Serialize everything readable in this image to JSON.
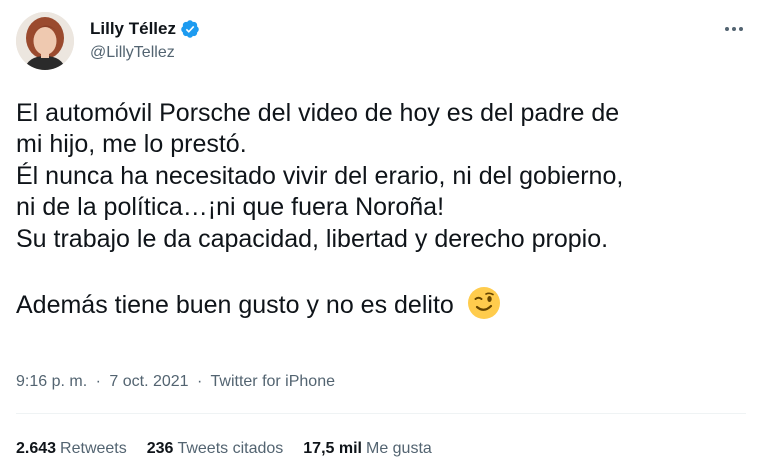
{
  "author": {
    "name": "Lilly Téllez",
    "handle": "@LillyTellez",
    "verified": true,
    "verified_color": "#1d9bf0"
  },
  "menu_icon": "more-horizontal-icon",
  "tweet": {
    "lines": [
      "El automóvil Porsche del video de hoy es del padre de",
      "mi hijo, me lo prestó.",
      "Él nunca ha necesitado vivir del erario, ni del gobierno,",
      "ni de la política…¡ni que fuera Noroña!",
      "Su trabajo le da capacidad, libertad y derecho propio.",
      "Además tiene buen gusto y no es delito"
    ],
    "emoji": "winking-face-emoji"
  },
  "meta": {
    "time": "9:16 p. m.",
    "separator": "·",
    "date": "7 oct. 2021",
    "source": "Twitter for iPhone"
  },
  "stats": {
    "retweets_count": "2.643",
    "retweets_label": "Retweets",
    "quotes_count": "236",
    "quotes_label": "Tweets citados",
    "likes_count": "17,5 mil",
    "likes_label": "Me gusta"
  },
  "colors": {
    "text": "#0f1419",
    "secondary": "#536471",
    "divider": "#eff3f4"
  }
}
